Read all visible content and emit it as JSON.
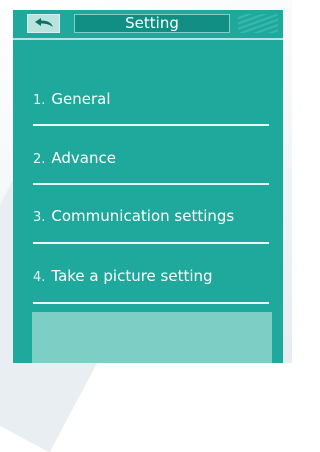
{
  "header": {
    "title": "Setting",
    "back_icon": "back-arrow-icon"
  },
  "menu": {
    "items": [
      {
        "number": "1.",
        "label": "General"
      },
      {
        "number": "2.",
        "label": "Advance"
      },
      {
        "number": "3.",
        "label": "Communication settings"
      },
      {
        "number": "4.",
        "label": "Take a picture setting"
      }
    ]
  },
  "colors": {
    "screen_background": "#1fa99c",
    "title_bar": "#118f84",
    "back_button": "#b9e4de",
    "bottom_panel": "#7dcfc5"
  }
}
